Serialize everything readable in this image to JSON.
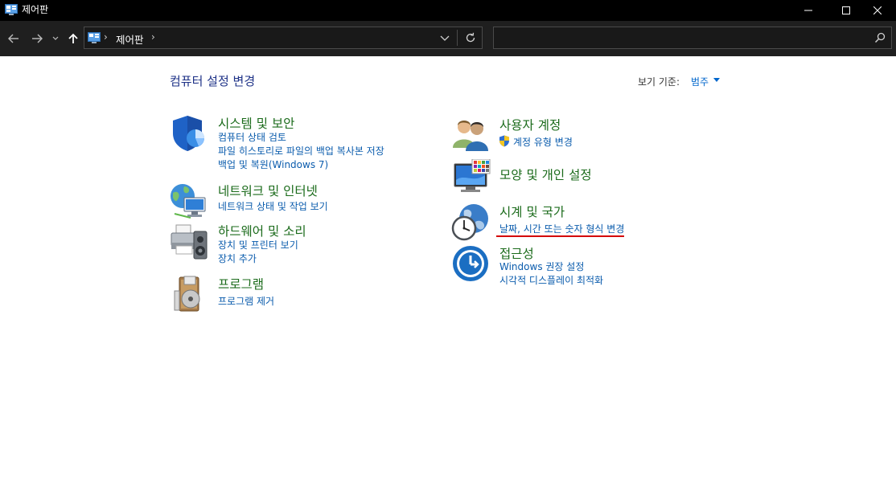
{
  "window": {
    "title": "제어판"
  },
  "address": {
    "crumb": "제어판",
    "separator": "›",
    "search_placeholder": ""
  },
  "header": {
    "title": "컴퓨터 설정 변경",
    "view_by_label": "보기 기준:",
    "view_by_value": "범주"
  },
  "categories": [
    {
      "title": "시스템 및 보안",
      "links": [
        "컴퓨터 상태 검토",
        "파일 히스토리로 파일의 백업 복사본 저장",
        "백업 및 복원(Windows 7)"
      ]
    },
    {
      "title": "네트워크 및 인터넷",
      "links": [
        "네트워크 상태 및 작업 보기"
      ]
    },
    {
      "title": "하드웨어 및 소리",
      "links": [
        "장치 및 프린터 보기",
        "장치 추가"
      ]
    },
    {
      "title": "프로그램",
      "links": [
        "프로그램 제거"
      ]
    },
    {
      "title": "사용자 계정",
      "links": [
        "계정 유형 변경"
      ]
    },
    {
      "title": "모양 및 개인 설정",
      "links": []
    },
    {
      "title": "시계 및 국가",
      "links": [
        "날짜, 시간 또는 숫자 형식 변경"
      ]
    },
    {
      "title": "접근성",
      "links": [
        "Windows 권장 설정",
        "시각적 디스플레이 최적화"
      ]
    }
  ],
  "colors": {
    "category_title": "#1b6b1b",
    "link": "#0b5cad",
    "highlight_underline": "#d40000"
  }
}
